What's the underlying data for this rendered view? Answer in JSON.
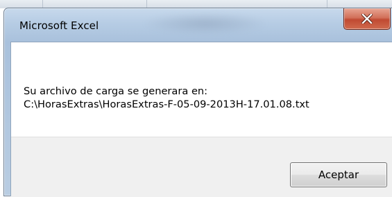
{
  "dialog": {
    "title": "Microsoft Excel",
    "close_icon": "close-icon",
    "message_line1": "Su archivo de carga se generara en:",
    "message_line2": "C:\\HorasExtras\\HorasExtras-F-05-09-2013H-17.01.08.txt",
    "ok_label": "Aceptar"
  },
  "colors": {
    "title_bar": "#b6cce4",
    "close_button": "#c04a32",
    "footer": "#f0f0f0",
    "content": "#ffffff"
  }
}
